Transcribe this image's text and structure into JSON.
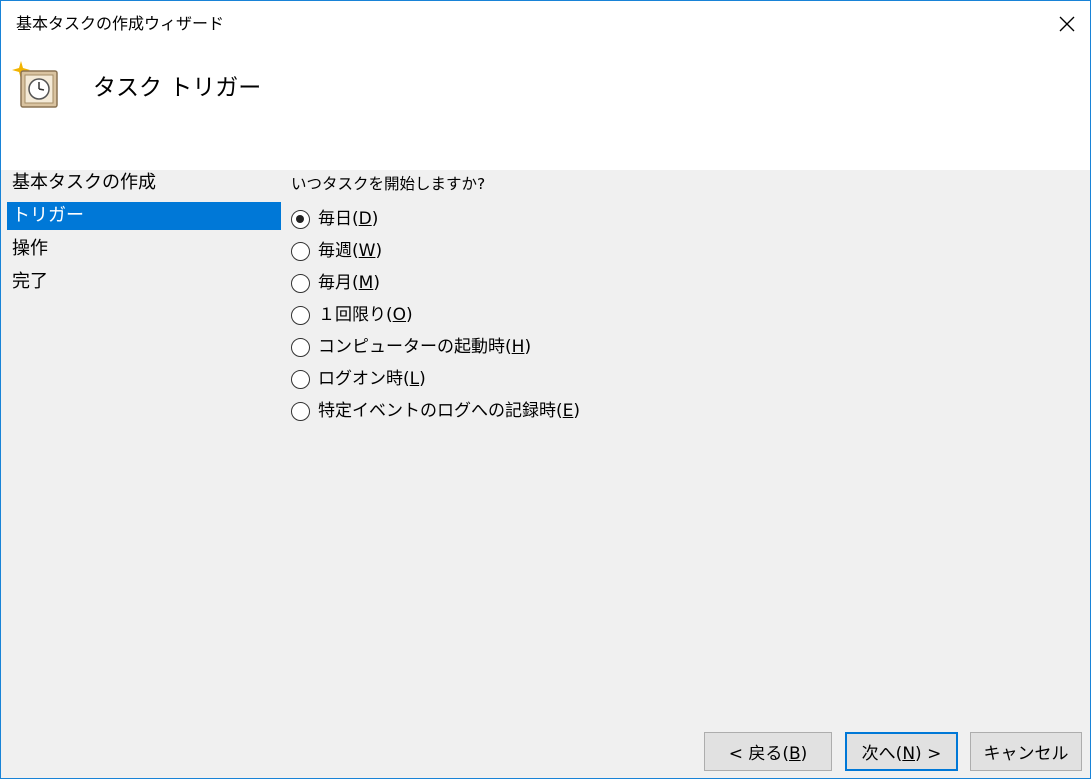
{
  "window": {
    "title": "基本タスクの作成ウィザード",
    "close_icon": "close-icon"
  },
  "header": {
    "title": "タスク トリガー",
    "icon": "task-clock-icon"
  },
  "steps": [
    {
      "label": "基本タスクの作成",
      "active": false
    },
    {
      "label": "トリガー",
      "active": true
    },
    {
      "label": "操作",
      "active": false
    },
    {
      "label": "完了",
      "active": false
    }
  ],
  "trigger": {
    "question": "いつタスクを開始しますか?",
    "options": [
      {
        "label": "毎日",
        "mnemonic": "D",
        "checked": true
      },
      {
        "label": "毎週",
        "mnemonic": "W",
        "checked": false
      },
      {
        "label": "毎月",
        "mnemonic": "M",
        "checked": false
      },
      {
        "label": "１回限り",
        "mnemonic": "O",
        "checked": false
      },
      {
        "label": "コンピューターの起動時",
        "mnemonic": "H",
        "checked": false
      },
      {
        "label": "ログオン時",
        "mnemonic": "L",
        "checked": false
      },
      {
        "label": "特定イベントのログへの記録時",
        "mnemonic": "E",
        "checked": false
      }
    ]
  },
  "buttons": {
    "back": {
      "prefix": "< 戻る(",
      "mnemonic": "B",
      "suffix": ")"
    },
    "next": {
      "prefix": "次へ(",
      "mnemonic": "N",
      "suffix": ") >"
    },
    "cancel": {
      "label": "キャンセル"
    }
  },
  "colors": {
    "accent": "#0078d7",
    "window_border": "#1883d7",
    "background": "#f0f0f0"
  }
}
